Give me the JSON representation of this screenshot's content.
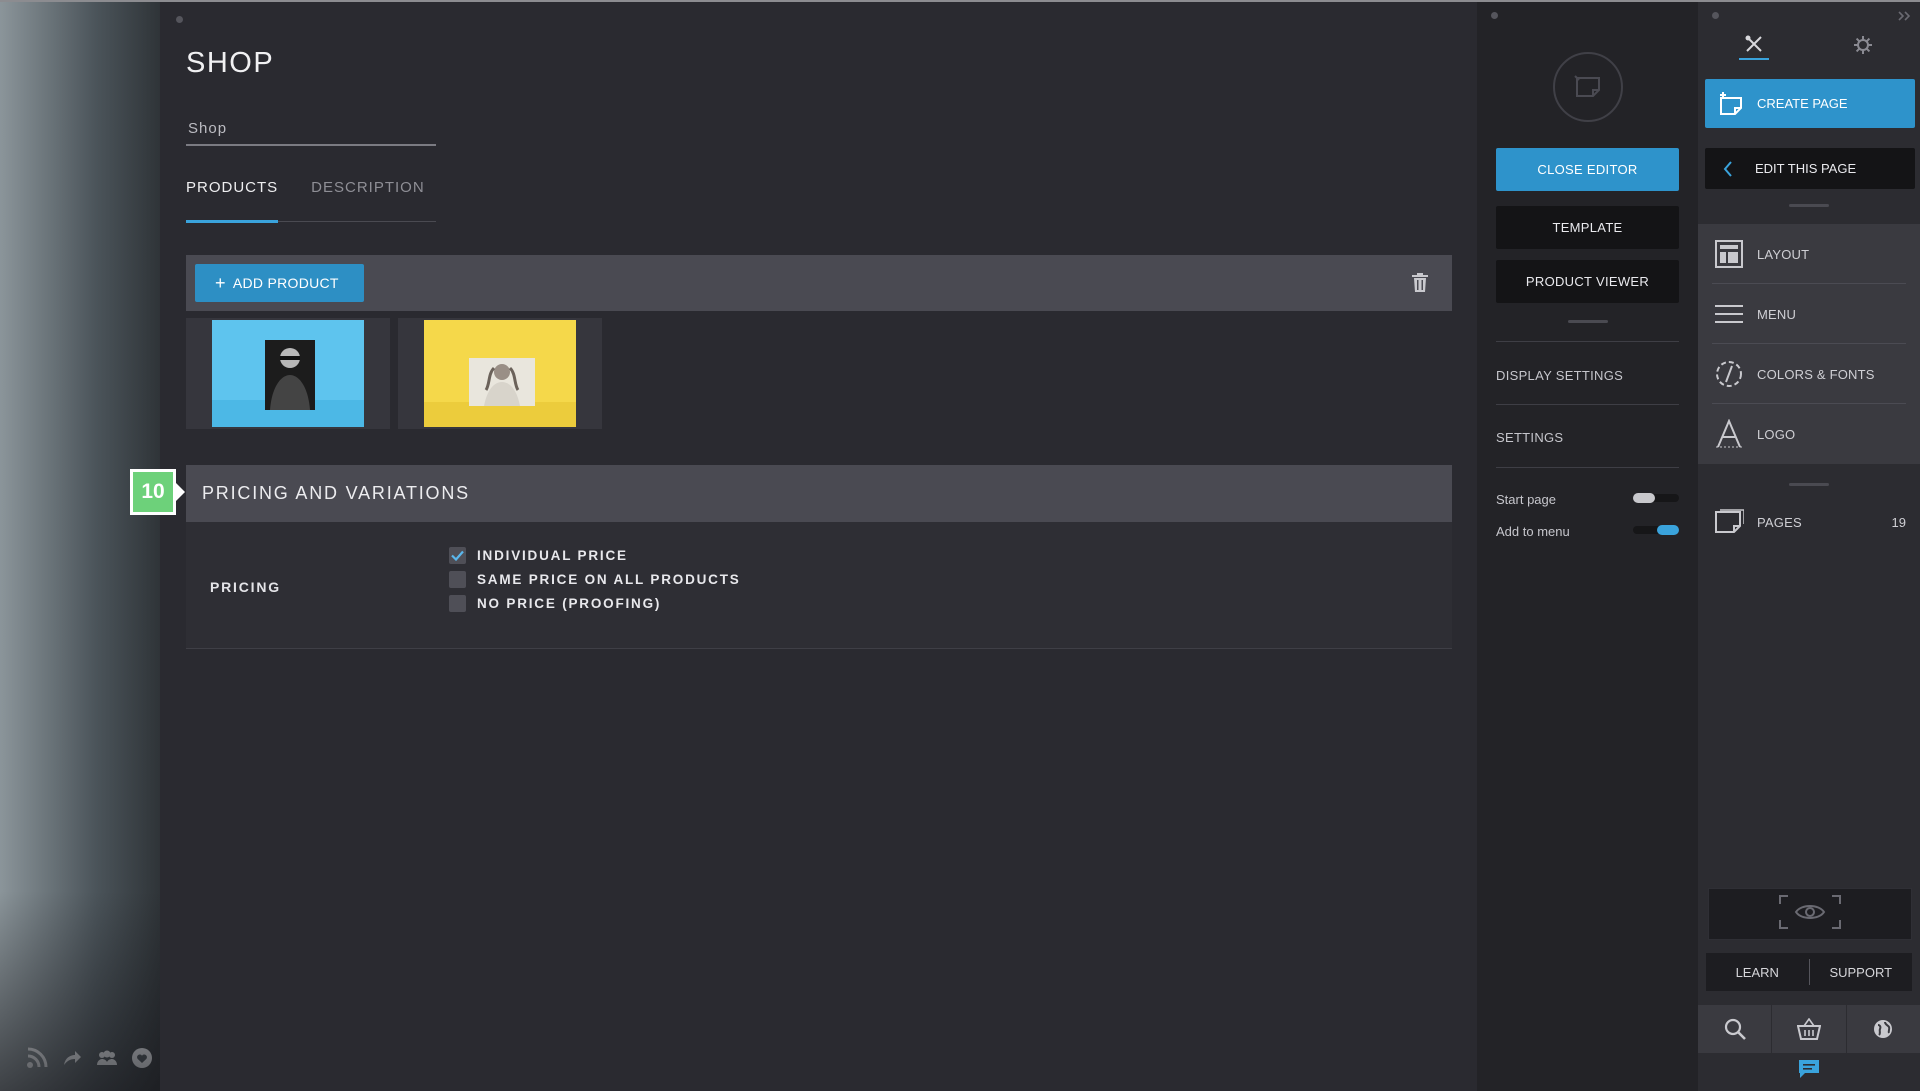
{
  "page": {
    "title": "SHOP",
    "name_field_value": "Shop",
    "tabs": [
      {
        "label": "PRODUCTS",
        "active": true
      },
      {
        "label": "DESCRIPTION",
        "active": false
      }
    ],
    "toolbar": {
      "add_product_label": "ADD PRODUCT"
    },
    "products": [
      {
        "background": "#5ec4ee"
      },
      {
        "background": "#f5d84a"
      }
    ],
    "pricing_section": {
      "step_number": "10",
      "title": "PRICING AND VARIATIONS",
      "pricing_label": "PRICING",
      "options": [
        {
          "label": "INDIVIDUAL PRICE",
          "checked": true
        },
        {
          "label": "SAME PRICE ON ALL PRODUCTS",
          "checked": false
        },
        {
          "label": "NO PRICE (PROOFING)",
          "checked": false
        }
      ]
    }
  },
  "editor_panel": {
    "close_editor": "CLOSE EDITOR",
    "template": "TEMPLATE",
    "product_viewer": "PRODUCT VIEWER",
    "display_settings": "DISPLAY SETTINGS",
    "settings": "SETTINGS",
    "start_page": {
      "label": "Start page",
      "on": false
    },
    "add_to_menu": {
      "label": "Add to menu",
      "on": true
    }
  },
  "site_panel": {
    "create_page": "CREATE PAGE",
    "edit_this_page": "EDIT THIS PAGE",
    "items": [
      {
        "label": "LAYOUT",
        "icon": "layout-icon"
      },
      {
        "label": "MENU",
        "icon": "menu-icon"
      },
      {
        "label": "COLORS & FONTS",
        "icon": "colors-fonts-icon"
      },
      {
        "label": "LOGO",
        "icon": "logo-icon"
      }
    ],
    "pages": {
      "label": "PAGES",
      "count": "19"
    },
    "learn": "LEARN",
    "support": "SUPPORT"
  },
  "colors": {
    "accent": "#2e93cb",
    "badge": "#6dd17a",
    "panel_dark": "#232327",
    "background": "#2a2a30"
  }
}
